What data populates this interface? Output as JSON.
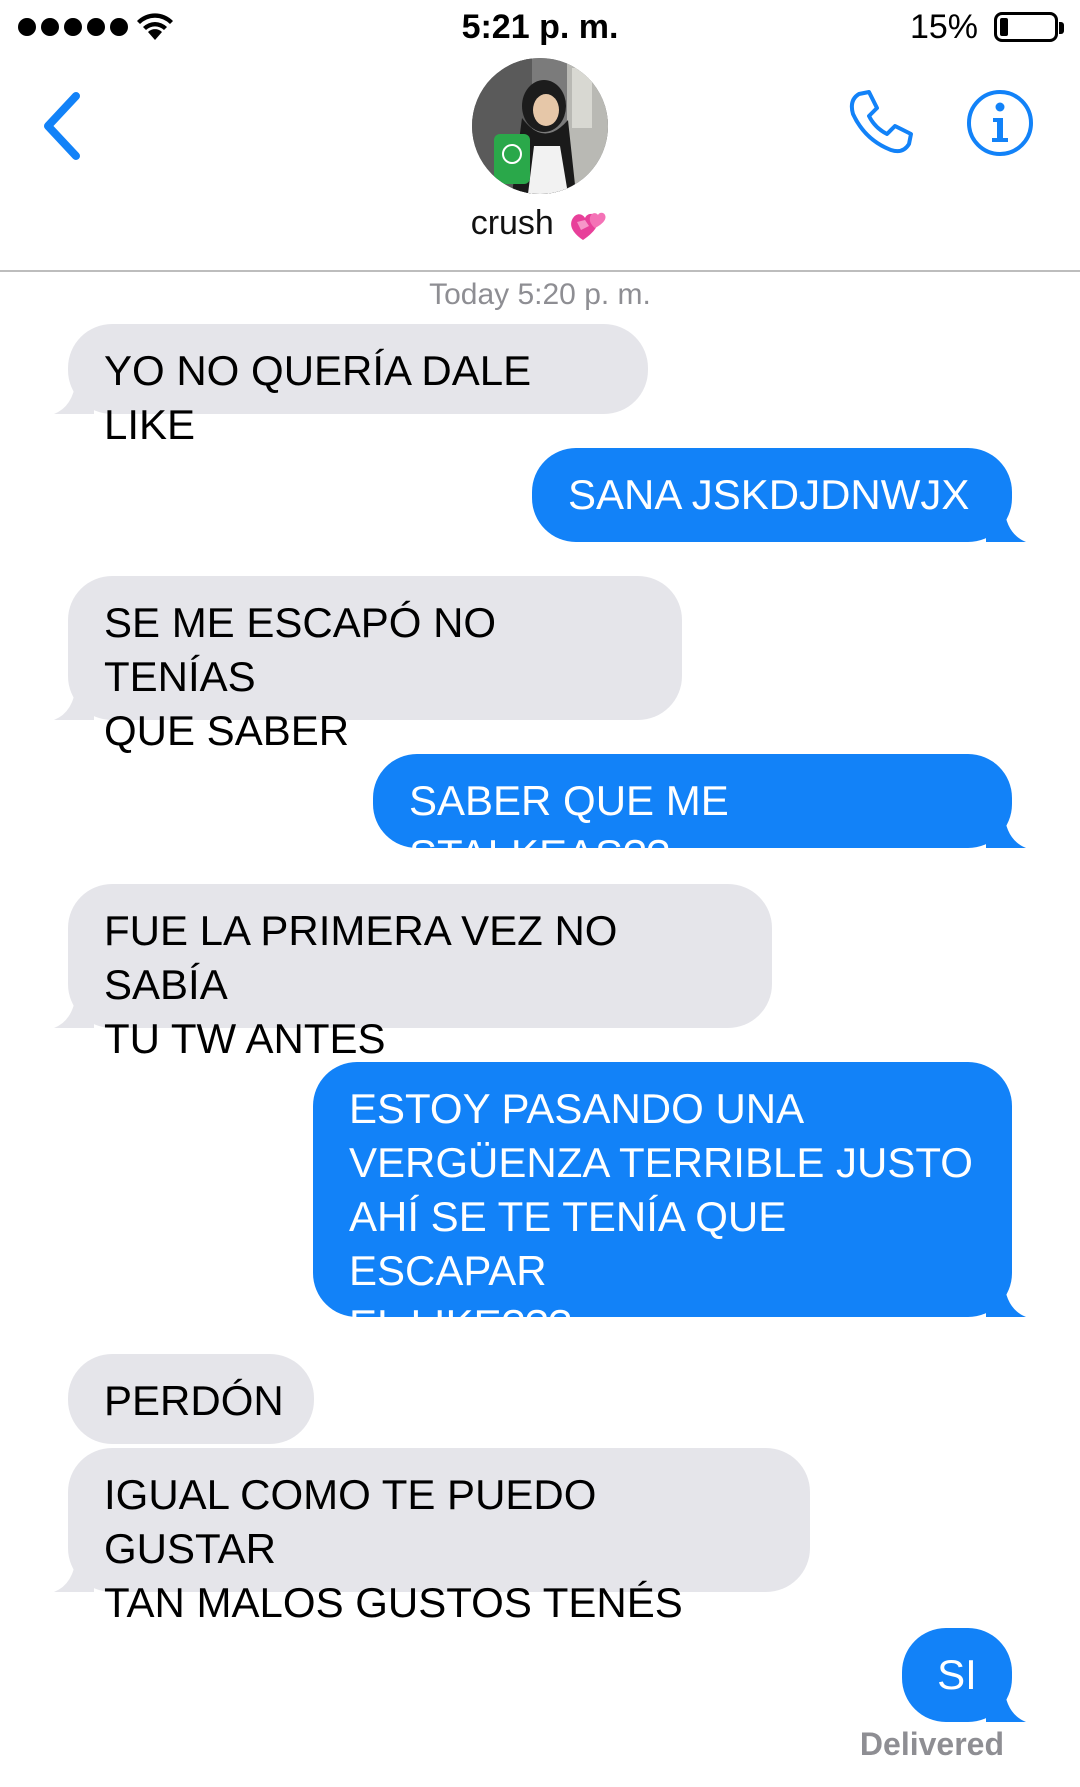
{
  "status_bar": {
    "time": "5:21 p. m.",
    "battery_percent": "15%",
    "battery_level": 0.15,
    "signal_bars": 5
  },
  "header": {
    "contact_name": "crush",
    "contact_emoji": "two-hearts-icon",
    "back_icon": "chevron-left-icon",
    "call_icon": "phone-icon",
    "info_icon": "info-icon"
  },
  "thread": {
    "timestamp": "Today 5:20 p. m.",
    "messages": [
      {
        "direction": "incoming",
        "text": "YO NO QUERÍA DALE LIKE"
      },
      {
        "direction": "outgoing",
        "text": "SANA JSKDJDNWJX"
      },
      {
        "direction": "incoming",
        "text": "SE ME ESCAPÓ NO TENÍAS\nQUE SABER"
      },
      {
        "direction": "outgoing",
        "text": "SABER QUE ME STALKEAS??"
      },
      {
        "direction": "incoming",
        "text": "FUE LA PRIMERA VEZ NO SABÍA\nTU TW ANTES"
      },
      {
        "direction": "outgoing",
        "text": "ESTOY PASANDO UNA\nVERGÜENZA TERRIBLE JUSTO\nAHÍ SE TE TENÍA QUE ESCAPAR\nEL LIKE???"
      },
      {
        "direction": "incoming",
        "text": "PERDÓN"
      },
      {
        "direction": "incoming",
        "text": "IGUAL COMO TE PUEDO GUSTAR\nTAN MALOS GUSTOS TENÉS"
      },
      {
        "direction": "outgoing",
        "text": "SI"
      }
    ],
    "delivery_status": "Delivered"
  },
  "colors": {
    "accent": "#1282f8",
    "incoming_bubble": "#e5e5ea",
    "secondary_text": "#8e8e93"
  }
}
